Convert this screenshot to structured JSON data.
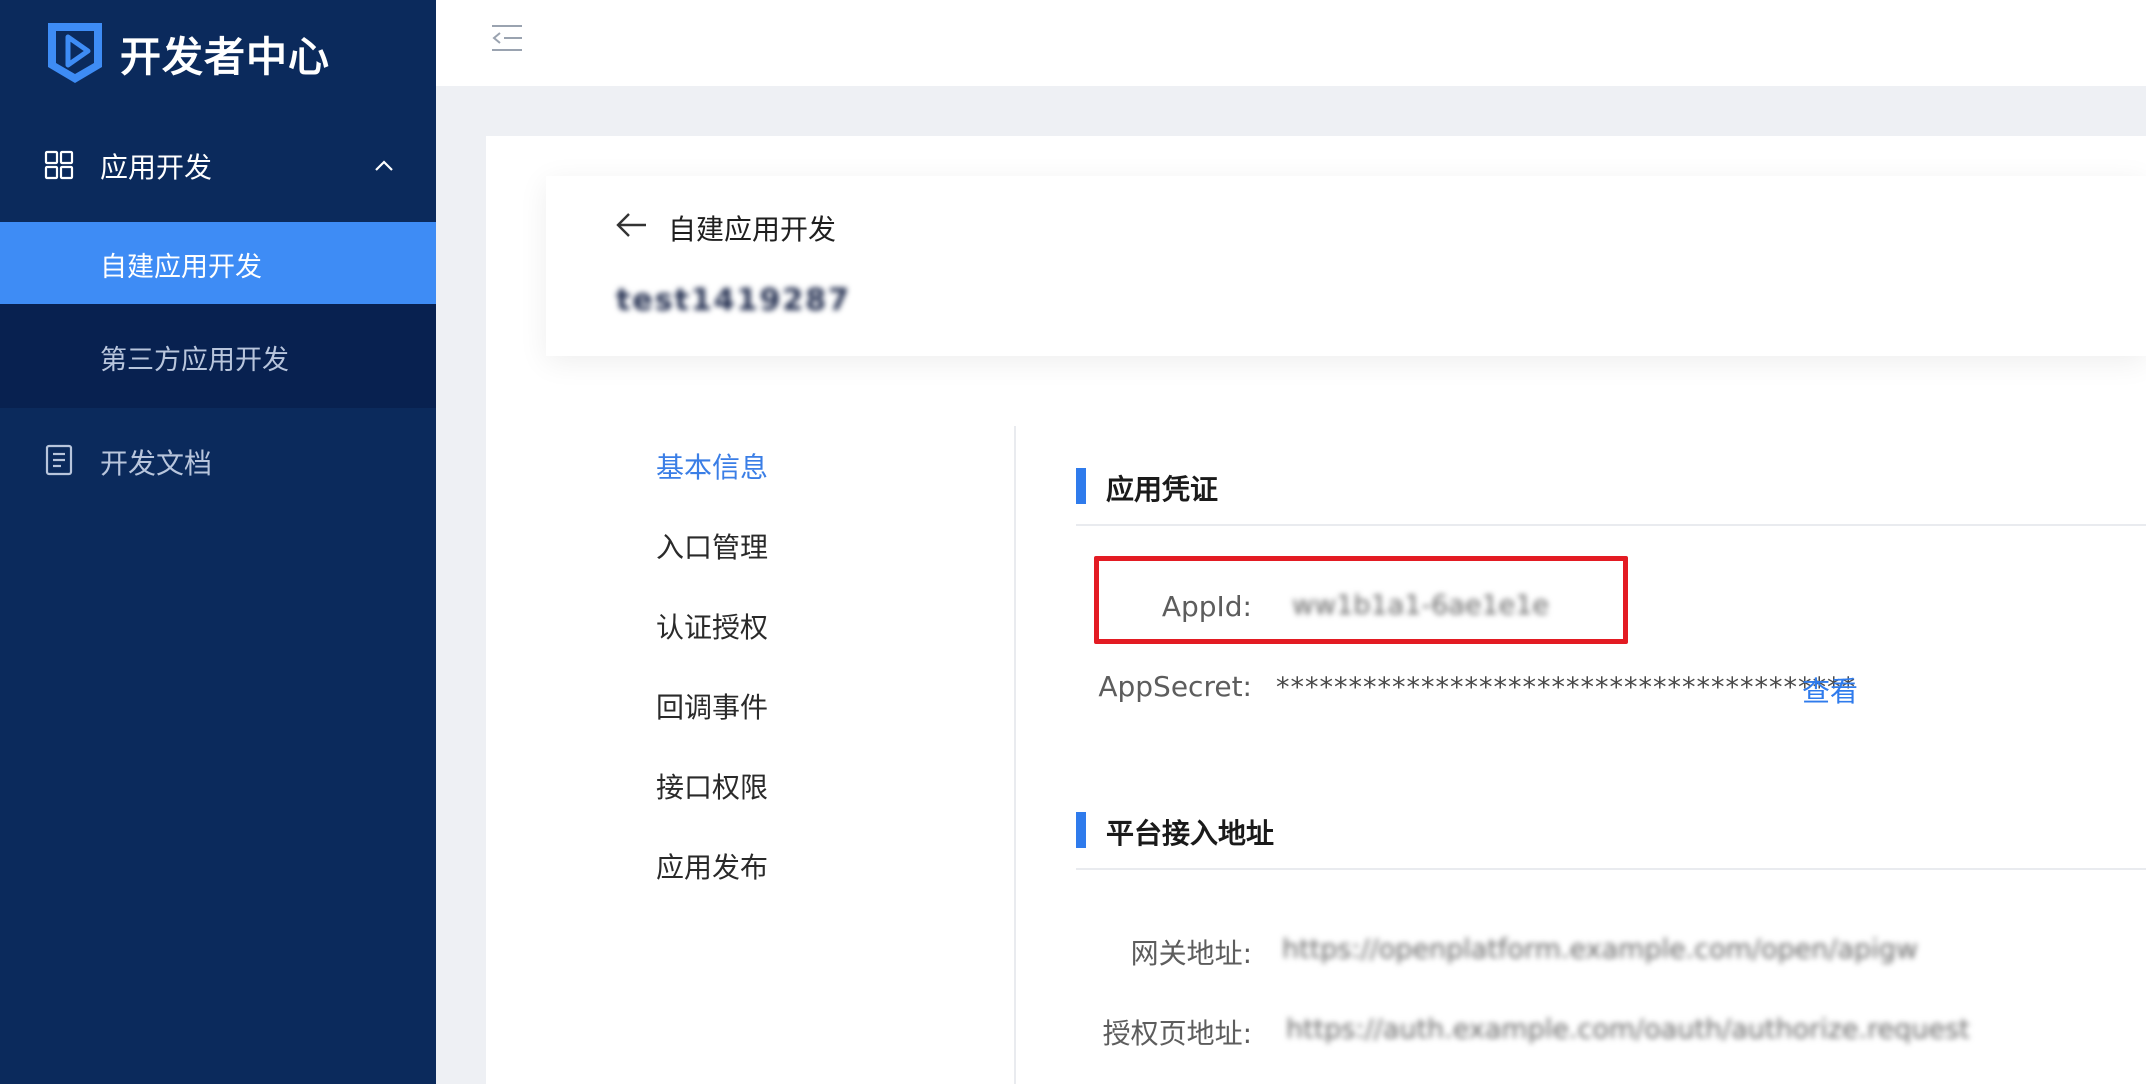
{
  "sidebar": {
    "brand_title": "开发者中心",
    "group_label": "应用开发",
    "active_item": "自建应用开发",
    "sub_item": "第三方应用开发",
    "docs_label": "开发文档"
  },
  "header": {
    "back_title": "自建应用开发",
    "app_name": "test1419287"
  },
  "tabs": [
    "基本信息",
    "入口管理",
    "认证授权",
    "回调事件",
    "接口权限",
    "应用发布"
  ],
  "sections": {
    "credentials": {
      "title": "应用凭证",
      "appid_label": "AppId:",
      "appid_value": "ww1b1a1-6ae1e1e",
      "secret_label": "AppSecret:",
      "secret_value": "****************************************",
      "view_label": "查看"
    },
    "platform": {
      "title": "平台接入地址",
      "gateway_label": "网关地址:",
      "gateway_value": "https://openplatform.example.com/open/apigw",
      "auth_label": "授权页地址:",
      "auth_value": "https://auth.example.com/oauth/authorize.request"
    }
  },
  "colors": {
    "sidebar_bg": "#0b2a5c",
    "active_item_bg": "#3e8cf5",
    "accent": "#2f7bec",
    "highlight_box": "#e31b23"
  },
  "icons": {
    "brand": "play-shield-logo-icon",
    "group": "grid-apps-icon",
    "docs": "document-icon",
    "collapse": "collapse-menu-icon",
    "back": "arrow-left-icon"
  }
}
